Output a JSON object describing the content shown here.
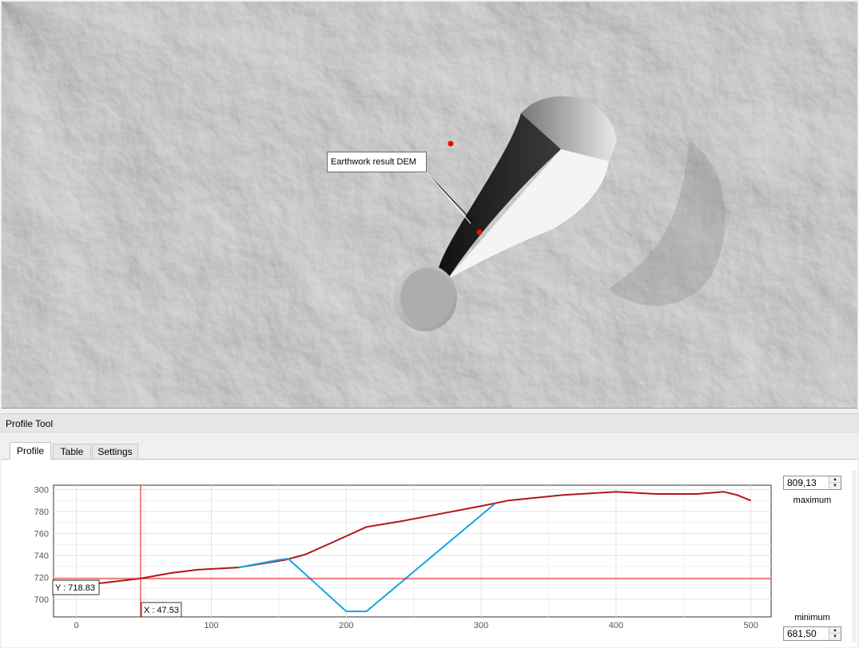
{
  "map": {
    "label": "Earthwork result DEM",
    "points": [
      "point-red",
      "point-red"
    ]
  },
  "dock": {
    "title": "Profile Tool",
    "tabs": [
      {
        "label": "Profile",
        "active": true
      },
      {
        "label": "Table",
        "active": false
      },
      {
        "label": "Settings",
        "active": false
      }
    ]
  },
  "profile": {
    "maximum_value": "809,13",
    "maximum_label": "maximum",
    "minimum_value": "681,50",
    "minimum_label": "minimum",
    "cursor_y_label": "Y : 718.83",
    "cursor_x_label": "X : 47.53",
    "colors": {
      "original": "#b01818",
      "result": "#19a3e0",
      "cursor": "#e01010"
    }
  },
  "chart_data": {
    "type": "line",
    "x_ticks": [
      0,
      100,
      200,
      300,
      400,
      500
    ],
    "y_ticks": [
      "700",
      "720",
      "740",
      "760",
      "780",
      "300"
    ],
    "xlim": [
      -17,
      515
    ],
    "ylim": [
      684,
      804
    ],
    "cursor": {
      "x": 47.53,
      "y": 718.83
    },
    "series": [
      {
        "color": "#b01818",
        "x": [
          0,
          20,
          47.5,
          70,
          90,
          120,
          155,
          170,
          190,
          215,
          240,
          270,
          300,
          320,
          360,
          400,
          430,
          460,
          470,
          480,
          490,
          500
        ],
        "y": [
          713,
          715,
          719,
          724,
          727,
          729,
          736,
          741,
          752,
          766,
          771,
          778,
          785,
          790,
          795,
          798,
          796,
          796,
          797,
          798,
          795,
          790
        ]
      },
      {
        "color": "#19a3e0",
        "x": [
          120,
          150,
          157,
          200,
          215,
          310
        ],
        "y": [
          729,
          736,
          737,
          689,
          689,
          787
        ]
      }
    ]
  }
}
